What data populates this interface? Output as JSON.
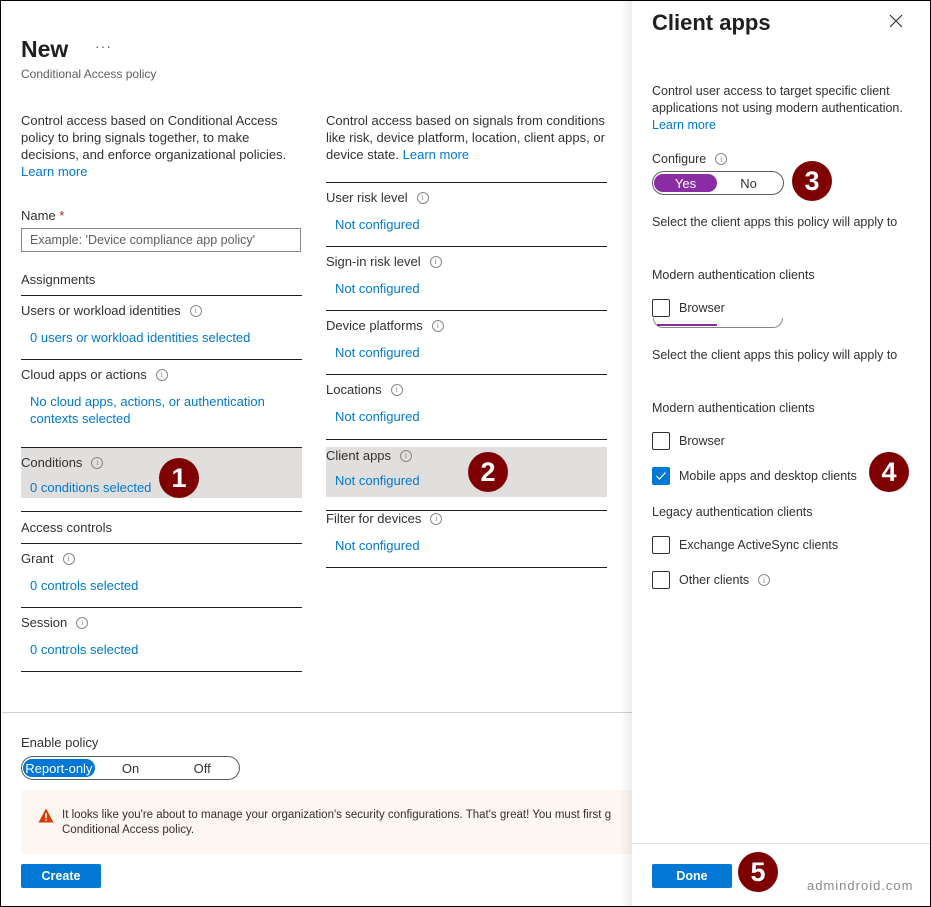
{
  "main": {
    "title": "New",
    "more_label": "···",
    "subtitle": "Conditional Access policy",
    "left": {
      "description": "Control access based on Conditional Access policy to bring signals together, to make decisions, and enforce organizational policies.",
      "learn_more": "Learn more",
      "name_label": "Name",
      "name_required_mark": "*",
      "name_value": "",
      "name_placeholder": "Example: 'Device compliance app policy'",
      "assignments_heading": "Assignments",
      "assignments": [
        {
          "label": "Users or workload identities",
          "value": "0 users or workload identities selected"
        },
        {
          "label": "Cloud apps or actions",
          "value": "No cloud apps, actions, or authentication contexts selected"
        },
        {
          "label": "Conditions",
          "value": "0 conditions selected",
          "highlighted": true
        }
      ],
      "access_controls_heading": "Access controls",
      "access_controls": [
        {
          "label": "Grant",
          "value": "0 controls selected"
        },
        {
          "label": "Session",
          "value": "0 controls selected"
        }
      ]
    },
    "right": {
      "description": "Control access based on signals from conditions like risk, device platform, location, client apps, or device state.",
      "learn_more": "Learn more",
      "conditions": [
        {
          "label": "User risk level",
          "value": "Not configured"
        },
        {
          "label": "Sign-in risk level",
          "value": "Not configured"
        },
        {
          "label": "Device platforms",
          "value": "Not configured"
        },
        {
          "label": "Locations",
          "value": "Not configured"
        },
        {
          "label": "Client apps",
          "value": "Not configured",
          "highlighted": true
        },
        {
          "label": "Filter for devices",
          "value": "Not configured"
        }
      ]
    },
    "enable_policy": {
      "label": "Enable policy",
      "options": [
        "Report-only",
        "On",
        "Off"
      ],
      "selected": "Report-only"
    },
    "warning": {
      "line1": "It looks like you're about to manage your organization's security configurations. That's great! You must first g",
      "line2": "Conditional Access policy."
    },
    "create_button": "Create"
  },
  "panel": {
    "title": "Client apps",
    "description": "Control user access to target specific client applications not using modern authentication.",
    "learn_more": "Learn more",
    "configure": {
      "label": "Configure",
      "options": [
        "Yes",
        "No"
      ],
      "selected": "Yes"
    },
    "ghost_section": {
      "select_text": "Select the client apps this policy will apply to",
      "modern_heading": "Modern authentication clients",
      "browser_label": "Browser"
    },
    "select_text": "Select the client apps this policy will apply to",
    "modern_heading": "Modern authentication clients",
    "modern_clients": [
      {
        "label": "Browser",
        "checked": false
      },
      {
        "label": "Mobile apps and desktop clients",
        "checked": true
      }
    ],
    "legacy_heading": "Legacy authentication clients",
    "legacy_clients": [
      {
        "label": "Exchange ActiveSync clients",
        "checked": false
      },
      {
        "label": "Other clients",
        "checked": false,
        "info": true
      }
    ],
    "done_button": "Done"
  },
  "annotations": [
    "1",
    "2",
    "3",
    "4",
    "5"
  ],
  "watermark": "admindroid.com",
  "colors": {
    "accent_blue": "#0078d4",
    "toggle_purple": "#8a2da5",
    "badge_red": "#7f0000",
    "highlight_gray": "#e1dfdd",
    "warning_bg": "#fdf6f1",
    "warning_icon": "#d83b01"
  }
}
